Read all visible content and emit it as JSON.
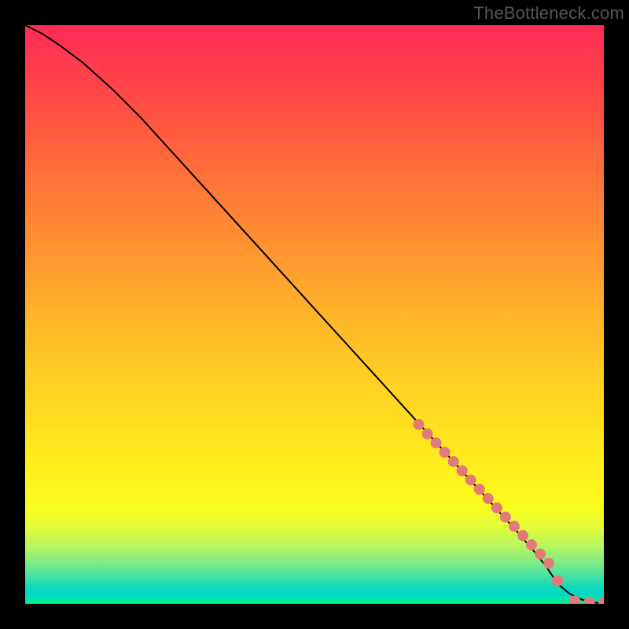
{
  "watermark": "TheBottleneck.com",
  "colors": {
    "background": "#000000",
    "curve": "#000000",
    "marker": "#e27a7a",
    "gradient_top": "#ff2a55",
    "gradient_mid": "#ffd722",
    "gradient_bottom": "#00f07a"
  },
  "chart_data": {
    "type": "line",
    "title": "",
    "xlabel": "",
    "ylabel": "",
    "xlim": [
      0,
      100
    ],
    "ylim": [
      0,
      100
    ],
    "grid": false,
    "series": [
      {
        "name": "curve",
        "style": "line",
        "x": [
          0,
          3,
          6,
          10,
          15,
          20,
          25,
          30,
          35,
          40,
          45,
          50,
          55,
          60,
          65,
          70,
          75,
          80,
          85,
          88,
          90,
          92,
          94,
          96,
          98,
          100
        ],
        "y": [
          100,
          98.5,
          96.5,
          93.5,
          89,
          84,
          78.5,
          73,
          67.5,
          62,
          56.5,
          51,
          45.5,
          40,
          34.5,
          29,
          23.5,
          18,
          12.5,
          9,
          6.5,
          3.5,
          1.8,
          0.8,
          0.3,
          0.0
        ]
      },
      {
        "name": "markers",
        "style": "scatter",
        "x": [
          68,
          69.5,
          71,
          72.5,
          74,
          75.5,
          77,
          78.5,
          80,
          81.5,
          83,
          84.5,
          86,
          87.5,
          89,
          90.5,
          92,
          95,
          97.5,
          100
        ],
        "y": [
          31,
          29.4,
          27.8,
          26.2,
          24.6,
          23,
          21.4,
          19.8,
          18.2,
          16.6,
          15,
          13.4,
          11.8,
          10.2,
          8.6,
          7,
          4,
          0.5,
          0.3,
          0.2
        ]
      }
    ]
  }
}
